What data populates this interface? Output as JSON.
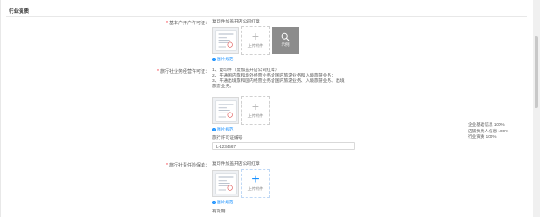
{
  "section": {
    "title": "行业资质"
  },
  "fields": {
    "opening_permit": {
      "label": "基本户开户许可证：",
      "desc": "复印件加盖开店公司红章",
      "upload_label": "上传附件",
      "example_label": "示例",
      "example_link": "图片规范"
    },
    "travel_permit": {
      "label": "旅行社业务经营许可证：",
      "desc_lines": [
        "1、复印件（需加盖开店公司红章）",
        "2、开通国内旅和境外经营业务含国内旅游业务和入境旅游业务；",
        "3、开通出境旅和国内经营业务含国内旅游业务、入境旅游业务、出境",
        "旅游业务。"
      ],
      "upload_label": "上传附件",
      "example_link": "图片规范",
      "number_label": "旅行许可证编号",
      "number_value": "L-1234567"
    },
    "liability_policy": {
      "label": "旅行社责任险保单：",
      "desc": "复印件加盖开店公司红章",
      "upload_label": "上传附件",
      "example_link": "图片规范",
      "valid_label": "有效期"
    }
  },
  "progress": {
    "lines": [
      "企业基础信息 100%",
      "店铺负责人信息 100%",
      "行业资质 100%"
    ]
  },
  "colors": {
    "accent": "#1890ff",
    "required": "#f5222d",
    "example_bg": "#8c8c8c"
  },
  "icons": [
    "plus-icon",
    "search-icon",
    "info-icon",
    "document-thumbnail"
  ]
}
